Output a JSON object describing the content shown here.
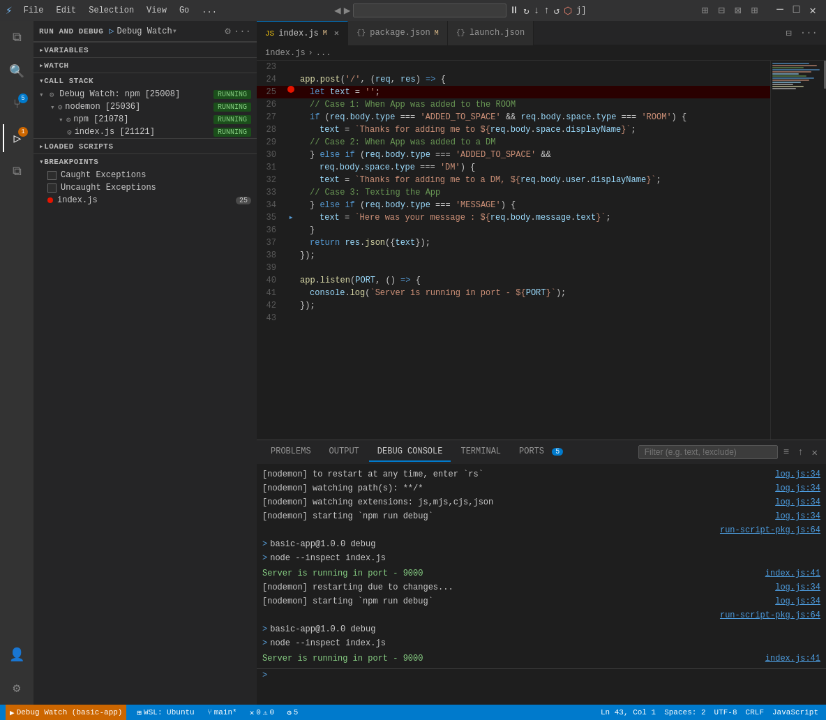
{
  "titlebar": {
    "icon": "⚡",
    "menus": [
      "File",
      "Edit",
      "Selection",
      "View",
      "Go",
      "..."
    ],
    "nav_back": "◀",
    "nav_fwd": "▶",
    "search_placeholder": "",
    "debug_controls": [
      "⏸",
      "↻",
      "↓",
      "↑",
      "↺",
      "⬡",
      "j]"
    ],
    "window_buttons": [
      "─",
      "□",
      "✕"
    ]
  },
  "sidebar": {
    "run_debug_label": "RUN AND DEBUG",
    "debug_config": "Debug Watch",
    "sections": {
      "variables": "VARIABLES",
      "watch": "WATCH",
      "call_stack": "CALL STACK",
      "loaded_scripts": "LOADED SCRIPTS",
      "breakpoints": "BREAKPOINTS"
    },
    "call_stack": {
      "process": "Debug Watch: npm [25008]",
      "process_status": "RUNNING",
      "children": [
        {
          "name": "nodemon [25036]",
          "status": "RUNNING",
          "indent": 1
        },
        {
          "name": "npm [21078]",
          "status": "RUNNING",
          "indent": 2
        },
        {
          "name": "index.js [21121]",
          "status": "RUNNING",
          "indent": 3
        }
      ]
    },
    "breakpoints": [
      {
        "type": "checkbox",
        "label": "Caught Exceptions",
        "checked": false
      },
      {
        "type": "checkbox",
        "label": "Uncaught Exceptions",
        "checked": false
      },
      {
        "type": "dot",
        "label": "index.js",
        "badge": "25"
      }
    ]
  },
  "tabs": [
    {
      "label": "index.js",
      "icon": "JS",
      "active": true,
      "dirty": true,
      "closeable": true
    },
    {
      "label": "package.json",
      "icon": "{}",
      "active": false,
      "dirty": true,
      "closeable": false
    },
    {
      "label": "launch.json",
      "icon": "{}",
      "active": false,
      "dirty": false,
      "closeable": false
    }
  ],
  "breadcrumb": [
    "index.js",
    "..."
  ],
  "code": {
    "lines": [
      {
        "num": 23,
        "tokens": []
      },
      {
        "num": 24,
        "raw": "app.post('/', (req, res) => {"
      },
      {
        "num": 25,
        "raw": "  let text = '';",
        "breakpoint": true
      },
      {
        "num": 26,
        "raw": "  // Case 1: When App was added to the ROOM"
      },
      {
        "num": 27,
        "raw": "  if (req.body.type === 'ADDED_TO_SPACE' && req.body.space.type === 'ROOM') {"
      },
      {
        "num": 28,
        "raw": "    text = `Thanks for adding me to ${req.body.space.displayName}`;"
      },
      {
        "num": 29,
        "raw": "  // Case 2: When App was added to a DM"
      },
      {
        "num": 30,
        "raw": "  } else if (req.body.type === 'ADDED_TO_SPACE' &&"
      },
      {
        "num": 31,
        "raw": "    req.body.space.type === 'DM') {"
      },
      {
        "num": 32,
        "raw": "    text = `Thanks for adding me to a DM, ${req.body.user.displayName}`;"
      },
      {
        "num": 33,
        "raw": "  // Case 3: Texting the App"
      },
      {
        "num": 34,
        "raw": "  } else if (req.body.type === 'MESSAGE') {"
      },
      {
        "num": 35,
        "raw": "    text = `Here was your message : ${req.body.message.text}`;"
      },
      {
        "num": 36,
        "raw": "  }"
      },
      {
        "num": 37,
        "raw": "  return res.json({text});"
      },
      {
        "num": 38,
        "raw": "});"
      },
      {
        "num": 39,
        "tokens": []
      },
      {
        "num": 40,
        "raw": "app.listen(PORT, () => {"
      },
      {
        "num": 41,
        "raw": "  console.log(`Server is running in port - ${PORT}`);"
      },
      {
        "num": 42,
        "raw": "});"
      },
      {
        "num": 43,
        "tokens": []
      }
    ]
  },
  "panel": {
    "tabs": [
      "PROBLEMS",
      "OUTPUT",
      "DEBUG CONSOLE",
      "TERMINAL",
      "PORTS"
    ],
    "active_tab": "DEBUG CONSOLE",
    "ports_badge": "5",
    "filter_placeholder": "Filter (e.g. text, !exclude)",
    "console_lines": [
      {
        "text": "[nodemon] to restart at any time, enter `rs`",
        "link": "log.js:34"
      },
      {
        "text": "[nodemon] watching path(s): **/*",
        "link": "log.js:34"
      },
      {
        "text": "[nodemon] watching extensions: js,mjs,cjs,json",
        "link": "log.js:34"
      },
      {
        "text": "[nodemon] starting `npm run debug`",
        "link": "log.js:34"
      },
      {
        "text": "",
        "link": "run-script-pkg.js:64"
      },
      {
        "text": "> basic-app@1.0.0 debug",
        "link": ""
      },
      {
        "text": "> node --inspect index.js",
        "link": ""
      },
      {
        "text": "",
        "link": ""
      },
      {
        "text": "Server is running in port - 9000",
        "link": "index.js:41"
      },
      {
        "text": "[nodemon] restarting due to changes...",
        "link": "log.js:34"
      },
      {
        "text": "[nodemon] starting `npm run debug`",
        "link": "log.js:34"
      },
      {
        "text": "",
        "link": "run-script-pkg.js:64"
      },
      {
        "text": "> basic-app@1.0.0 debug",
        "link": ""
      },
      {
        "text": "> node --inspect index.js",
        "link": ""
      },
      {
        "text": "",
        "link": ""
      },
      {
        "text": "Server is running in port - 9000",
        "link": "index.js:41"
      }
    ]
  },
  "statusbar": {
    "debug": "Debug Watch (basic-app)",
    "wsl": "WSL: Ubuntu",
    "branch": "main*",
    "errors": "0",
    "warnings": "0",
    "debug_count": "5",
    "ln_col": "Ln 43, Col 1",
    "spaces": "Spaces: 2",
    "encoding": "UTF-8",
    "line_ending": "CRLF",
    "language": "JavaScript"
  }
}
